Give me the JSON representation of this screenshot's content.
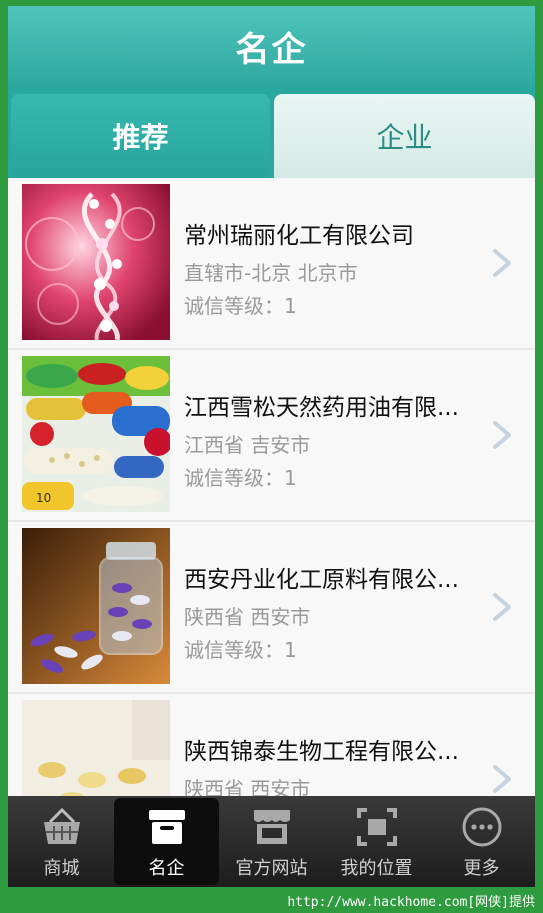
{
  "header": {
    "title": "名企"
  },
  "tabs": [
    {
      "label": "推荐",
      "active": true
    },
    {
      "label": "企业",
      "active": false
    }
  ],
  "companies": [
    {
      "name": "常州瑞丽化工有限公司",
      "location": "直辖市-北京 北京市",
      "credit": "诚信等级：1",
      "image": "dna-helix-image"
    },
    {
      "name": "江西雪松天然药用油有限...",
      "location": "江西省 吉安市",
      "credit": "诚信等级：1",
      "image": "capsules-pills-image"
    },
    {
      "name": "西安丹业化工原料有限公...",
      "location": "陕西省 西安市",
      "credit": "诚信等级：1",
      "image": "pill-bottle-image"
    },
    {
      "name": "陕西锦泰生物工程有限公...",
      "location": "陕西省 西安市",
      "credit": "",
      "image": "softgel-capsules-image"
    }
  ],
  "nav": [
    {
      "label": "商城",
      "icon": "basket-icon",
      "active": false
    },
    {
      "label": "名企",
      "icon": "store-box-icon",
      "active": true
    },
    {
      "label": "官方网站",
      "icon": "shop-awning-icon",
      "active": false
    },
    {
      "label": "我的位置",
      "icon": "location-frame-icon",
      "active": false
    },
    {
      "label": "更多",
      "icon": "more-circle-icon",
      "active": false
    }
  ],
  "watermark": "http://www.hackhome.com[网侠]提供",
  "colors": {
    "accent": "#2fa9a0",
    "tab_inactive": "#d5eae6",
    "nav_bg": "#1d1d1d"
  }
}
